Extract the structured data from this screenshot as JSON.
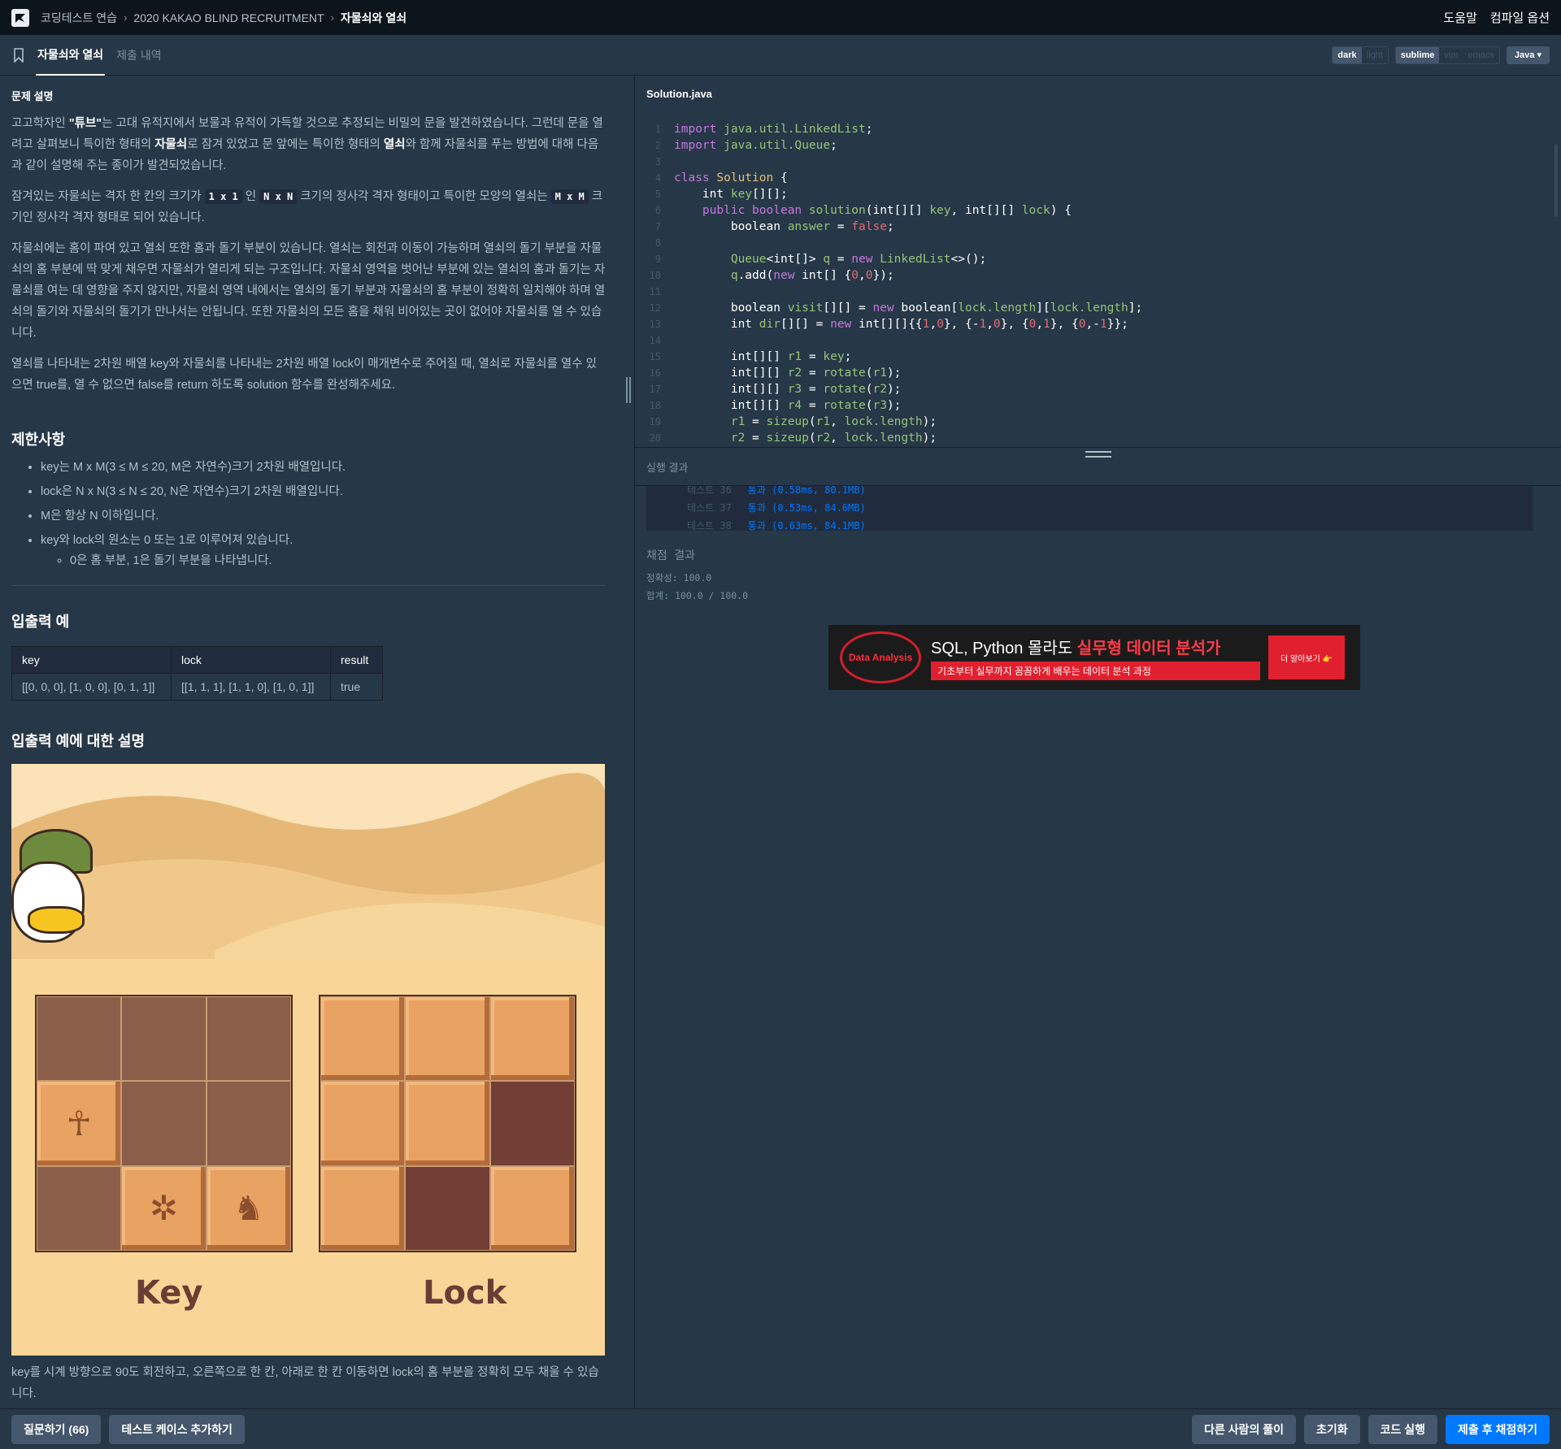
{
  "nav": {
    "breadcrumbs": [
      "코딩테스트 연습",
      "2020 KAKAO BLIND RECRUITMENT",
      "자물쇠와 열쇠"
    ],
    "help": "도움말",
    "compile_options": "컴파일 옵션"
  },
  "tabs": {
    "problem": "자물쇠와 열쇠",
    "submissions": "제출 내역"
  },
  "options": {
    "theme": [
      "dark",
      "light"
    ],
    "keymap": [
      "sublime",
      "vim",
      "emacs"
    ],
    "language": "Java"
  },
  "problem": {
    "section_title": "문제 설명",
    "p1_a": "고고학자인 ",
    "p1_b": "\"튜브\"",
    "p1_c": "는 고대 유적지에서 보물과 유적이 가득할 것으로 추정되는 비밀의 문을 발견하였습니다. 그런데 문을 열려고 살펴보니 특이한 형태의 ",
    "p1_d": "자물쇠",
    "p1_e": "로 잠겨 있었고 문 앞에는 특이한 형태의 ",
    "p1_f": "열쇠",
    "p1_g": "와 함께 자물쇠를 푸는 방법에 대해 다음과 같이 설명해 주는 종이가 발견되었습니다.",
    "p2_a": "잠겨있는 자물쇠는 격자 한 칸의 크기가 ",
    "p2_code1": "1 x 1",
    "p2_b": " 인 ",
    "p2_code2": "N x N",
    "p2_c": " 크기의 정사각 격자 형태이고 특이한 모양의 열쇠는 ",
    "p2_code3": "M x M",
    "p2_d": " 크기인 정사각 격자 형태로 되어 있습니다.",
    "p3": "자물쇠에는 홈이 파여 있고 열쇠 또한 홈과 돌기 부분이 있습니다. 열쇠는 회전과 이동이 가능하며 열쇠의 돌기 부분을 자물쇠의 홈 부분에 딱 맞게 채우면 자물쇠가 열리게 되는 구조입니다. 자물쇠 영역을 벗어난 부분에 있는 열쇠의 홈과 돌기는 자물쇠를 여는 데 영향을 주지 않지만, 자물쇠 영역 내에서는 열쇠의 돌기 부분과 자물쇠의 홈 부분이 정확히 일치해야 하며 열쇠의 돌기와 자물쇠의 돌기가 만나서는 안됩니다. 또한 자물쇠의 모든 홈을 채워 비어있는 곳이 없어야 자물쇠를 열 수 있습니다.",
    "p4": "열쇠를 나타내는 2차원 배열 key와 자물쇠를 나타내는 2차원 배열 lock이 매개변수로 주어질 때, 열쇠로 자물쇠를 열수 있으면 true를, 열 수 없으면 false를 return 하도록 solution 함수를 완성해주세요.",
    "constraints_title": "제한사항",
    "constraints": [
      "key는 M x M(3 ≤ M ≤ 20, M은 자연수)크기 2차원 배열입니다.",
      "lock은 N x N(3 ≤ N ≤ 20, N은 자연수)크기 2차원 배열입니다.",
      "M은 항상 N 이하입니다.",
      "key와 lock의 원소는 0 또는 1로 이루어져 있습니다."
    ],
    "sub_constraint": "0은 홈 부분, 1은 돌기 부분을 나타냅니다.",
    "io_title": "입출력 예",
    "io_headers": [
      "key",
      "lock",
      "result"
    ],
    "io_row": [
      "[[0, 0, 0], [1, 0, 0], [0, 1, 1]]",
      "[[1, 1, 1], [1, 1, 0], [1, 0, 1]]",
      "true"
    ],
    "io_explain_title": "입출력 예에 대한 설명",
    "illustration_key": "Key",
    "illustration_lock": "Lock",
    "explain": "key를 시계 방향으로 90도 회전하고, 오른쪽으로 한 칸, 아래로 한 칸 이동하면 lock의 홈 부분을 정확히 모두 채울 수 있습니다."
  },
  "editor": {
    "filename": "Solution.java",
    "line_numbers": [
      "1",
      "2",
      "3",
      "4",
      "5",
      "6",
      "7",
      "8",
      "9",
      "10",
      "11",
      "12",
      "13",
      "14",
      "15",
      "16",
      "17",
      "18",
      "19",
      "20"
    ]
  },
  "results": {
    "title": "실행 결과",
    "tests": [
      {
        "label": "테스트 36",
        "result": "통과 (0.58ms, 80.1MB)"
      },
      {
        "label": "테스트 37",
        "result": "통과 (0.53ms, 84.6MB)"
      },
      {
        "label": "테스트 38",
        "result": "통과 (0.63ms, 84.1MB)"
      }
    ],
    "score_title": "채점 결과",
    "accuracy": "정확성: 100.0",
    "total": "합계: 100.0 / 100.0"
  },
  "ad": {
    "logo": "Data Analysis",
    "title_a": "SQL, Python 몰라도 ",
    "title_b": "실무형 데이터 분석가",
    "sub": "기초부터 실무까지 꼼꼼하게 배우는 데이터 분석 과정",
    "button": "더 알아보기 👉"
  },
  "bottom": {
    "ask": "질문하기 (66)",
    "add_test": "테스트 케이스 추가하기",
    "others": "다른 사람의 풀이",
    "reset": "초기화",
    "run": "코드 실행",
    "submit": "제출 후 채점하기"
  },
  "colors": {
    "background": "#263747",
    "nav": "#0c151c",
    "primary_button": "#0078ff",
    "secondary_button": "#44576c"
  }
}
